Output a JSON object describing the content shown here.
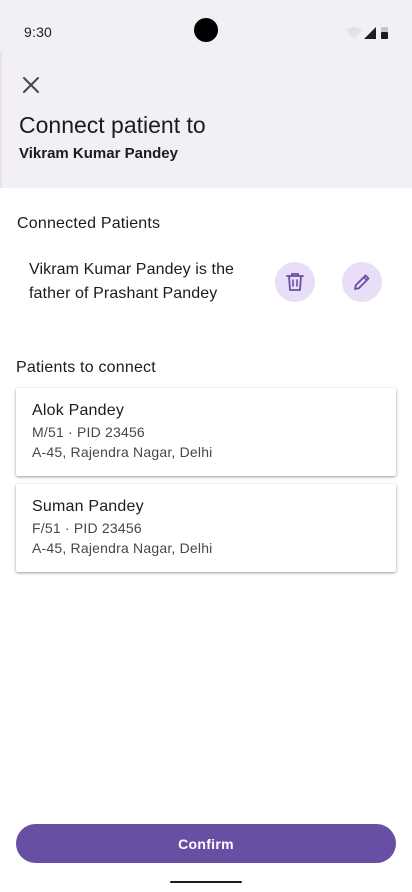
{
  "status_bar": {
    "time": "9:30",
    "icons": [
      "wifi-icon",
      "signal-icon",
      "battery-icon"
    ]
  },
  "header": {
    "close_icon": "close-icon",
    "title": "Connect patient to",
    "subtitle": "Vikram Kumar Pandey"
  },
  "connected": {
    "section_label": "Connected Patients",
    "items": [
      {
        "text": "Vikram Kumar Pandey is the father of Prashant Pandey",
        "delete_icon": "trash-icon",
        "edit_icon": "pencil-icon"
      }
    ]
  },
  "to_connect": {
    "section_label": "Patients to connect",
    "patients": [
      {
        "name": "Alok Pandey",
        "meta": "M/51 · PID 23456",
        "address": "A-45, Rajendra Nagar, Delhi"
      },
      {
        "name": "Suman Pandey",
        "meta": "F/51 · PID 23456",
        "address": "A-45, Rajendra Nagar, Delhi"
      }
    ]
  },
  "footer": {
    "confirm_label": "Confirm"
  },
  "colors": {
    "primary": "#6750a4",
    "icon_button_bg": "#e8def8",
    "header_bg": "#f2eff5"
  }
}
